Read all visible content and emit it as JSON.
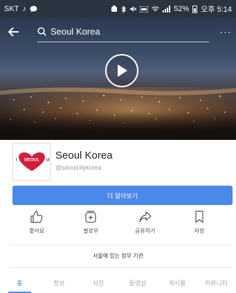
{
  "status_bar": {
    "carrier": "SKT",
    "battery": "52%",
    "time": "오후 5:14"
  },
  "topbar": {
    "search_value": "Seoul Korea"
  },
  "profile": {
    "name": "Seoul Korea",
    "handle": "@seoulcitykorea",
    "logo_text": "I·SEOUL·U"
  },
  "learn_more": {
    "label": "더 알아보기"
  },
  "actions": [
    {
      "label": "좋아요",
      "icon": "thumbs-up-icon"
    },
    {
      "label": "팔로우",
      "icon": "follow-icon"
    },
    {
      "label": "공유하기",
      "icon": "share-icon"
    },
    {
      "label": "저장",
      "icon": "bookmark-icon"
    }
  ],
  "category": "서울에 있는 정부 기관",
  "tabs": [
    {
      "label": "홈",
      "active": true
    },
    {
      "label": "정보",
      "active": false
    },
    {
      "label": "사진",
      "active": false
    },
    {
      "label": "동영상",
      "active": false
    },
    {
      "label": "게시물",
      "active": false
    },
    {
      "label": "커뮤니티",
      "active": false
    }
  ],
  "colors": {
    "accent": "#4c88e8",
    "logo_red": "#d21f3c"
  }
}
